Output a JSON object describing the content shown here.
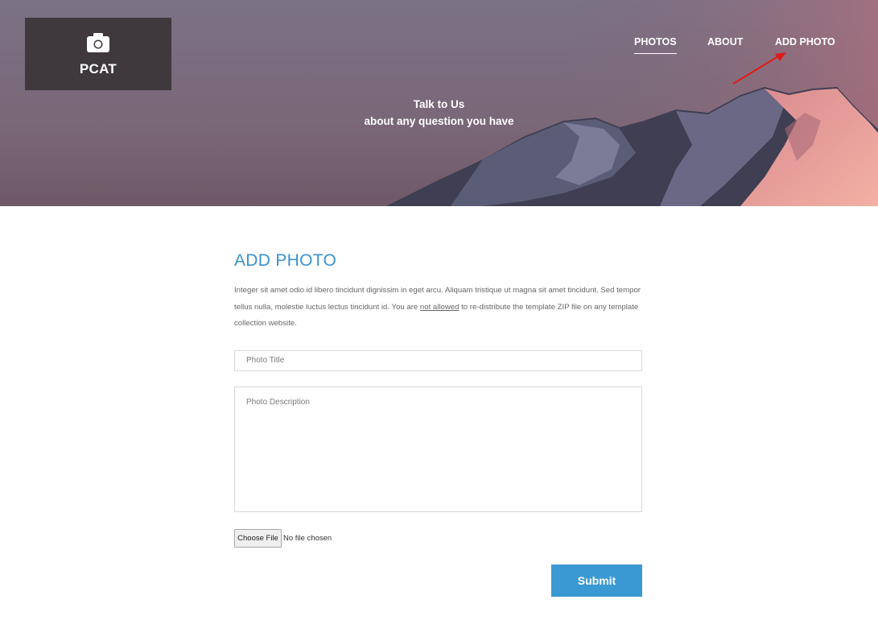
{
  "header": {
    "logo_text": "PCAT",
    "logo_icon": "camera-icon",
    "nav": {
      "photos": "PHOTOS",
      "about": "ABOUT",
      "add_photo": "ADD PHOTO"
    },
    "tagline_line1": "Talk to Us",
    "tagline_line2": "about any question you have"
  },
  "main": {
    "title": "ADD PHOTO",
    "description_before": "Integer sit amet odio id libero tincidunt dignissim in eget arcu. Aliquam tristique ut magna sit amet tincidunt. Sed tempor tellus nulla, molestie luctus lectus tincidunt id. You are ",
    "description_link": "not allowed",
    "description_after": " to re-distribute the template ZIP file on any template collection website.",
    "form": {
      "title_placeholder": "Photo Title",
      "description_placeholder": "Photo Description",
      "file_button": "Choose File",
      "file_status": "No file chosen",
      "submit": "Submit"
    }
  },
  "colors": {
    "accent": "#3a93d0",
    "button": "#3a99d3",
    "logo_bg": "#3f383d",
    "annotation_arrow": "#e11b1b"
  }
}
